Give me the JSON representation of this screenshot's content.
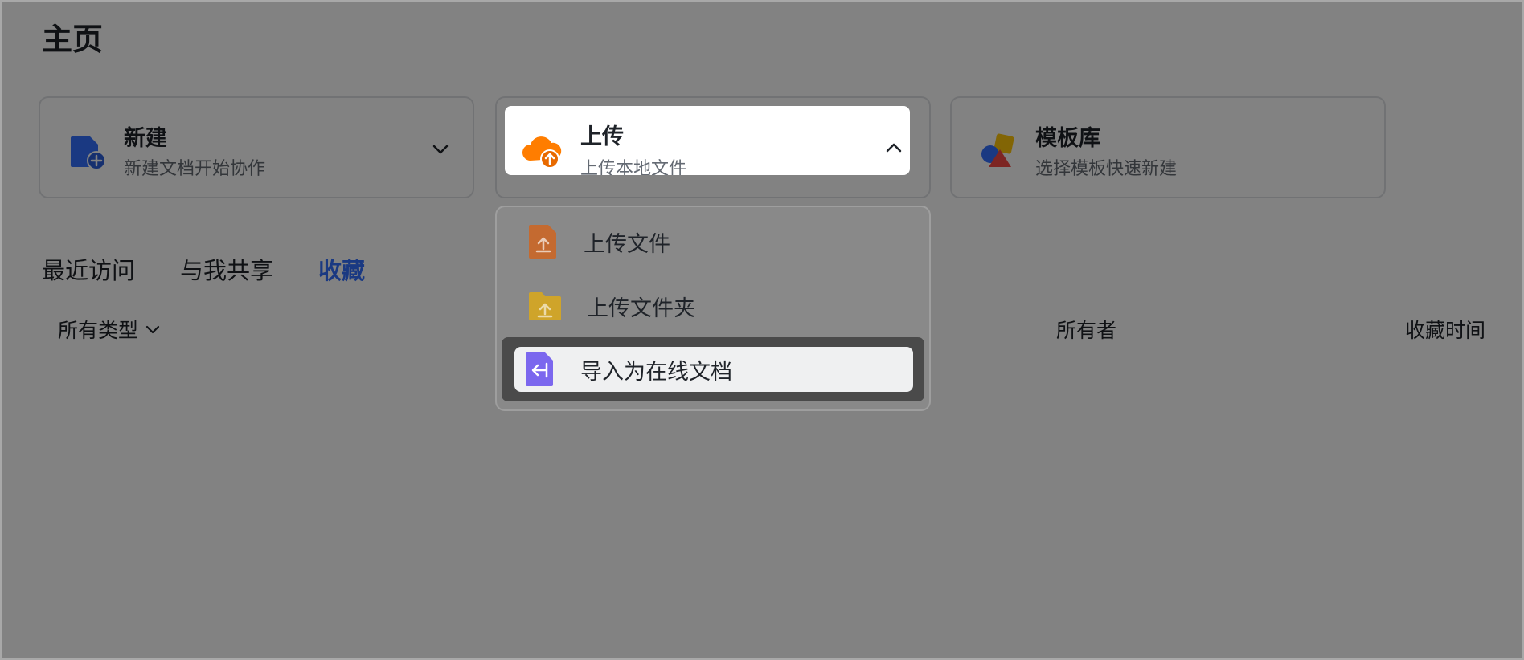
{
  "page": {
    "title": "主页"
  },
  "cards": {
    "new": {
      "title": "新建",
      "subtitle": "新建文档开始协作"
    },
    "upload": {
      "title": "上传",
      "subtitle": "上传本地文件"
    },
    "template": {
      "title": "模板库",
      "subtitle": "选择模板快速新建"
    }
  },
  "tabs": [
    {
      "label": "最近访问"
    },
    {
      "label": "与我共享"
    },
    {
      "label": "收藏"
    }
  ],
  "table": {
    "filter_label": "所有类型",
    "owner_label": "所有者",
    "fav_time_label": "收藏时间"
  },
  "upload_menu": {
    "items": [
      {
        "label": "上传文件",
        "icon": "upload-file-icon"
      },
      {
        "label": "上传文件夹",
        "icon": "upload-folder-icon"
      },
      {
        "label": "导入为在线文档",
        "icon": "import-doc-icon"
      }
    ]
  },
  "colors": {
    "accent": "#3370ff",
    "new_icon": "#3370ff",
    "upload_icon": "#ff7d00",
    "file_icon": "#f57e2e",
    "folder_icon": "#ffc60a",
    "import_icon": "#7b67ee",
    "template_red": "#f54a45",
    "template_yellow": "#ffc60a",
    "template_blue": "#3370ff"
  }
}
